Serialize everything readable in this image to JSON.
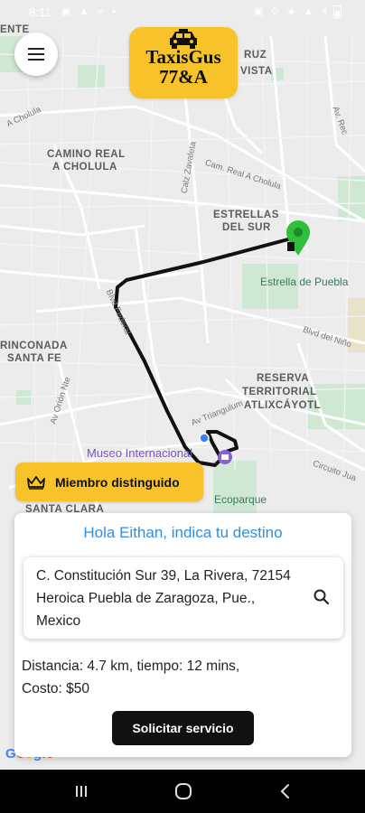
{
  "status_bar": {
    "time": "8:11",
    "left_icons": "▣ ▲ ∞ •",
    "right_icons": "▣ ⊙ ◈ ▲ 4"
  },
  "map_labels": {
    "ente": "ENTE",
    "cruz": "RUZ",
    "vista": "VISTA",
    "camino_real_1": "CAMINO REAL",
    "camino_real_2": "A CHOLULA",
    "estrellas_1": "ESTRELLAS",
    "estrellas_2": "DEL SUR",
    "estrella_puebla": "Estrella de Puebla",
    "rinconada_1": "RINCONADA",
    "rinconada_2": "SANTA FE",
    "reserva_1": "RESERVA",
    "reserva_2": "TERRITORIAL",
    "reserva_3": "ATLIXCÁYOTL",
    "museo_1": "Museo Internacional",
    "ecoparque": "Ecoparque",
    "santa_clara": "SANTA CLARA",
    "road_cholula": "A Cholula",
    "road_camreal": "Cam. Real A Cholula",
    "road_zavaleta": "Calz Zavaleta",
    "road_blvd_nino": "Blvd del Niño",
    "road_triangulum": "Av Triangulum",
    "road_orion": "Av Orión Nte",
    "road_blvd_fed": "Blvd Federal",
    "road_circuito": "Circuito Jua",
    "road_rec": "Av. Rec"
  },
  "logo": {
    "line1": "TaxisGus",
    "line2": "77&A"
  },
  "badge": {
    "label": "Miembro distinguido"
  },
  "card": {
    "greeting": "Hola Eithan, indica tu destino",
    "address": "C. Constitución Sur 39, La Rivera, 72154 Heroica Puebla de Zaragoza, Pue., Mexico",
    "distance_line": "Distancia: 4.7 km, tiempo: 12 mins,",
    "cost_line": "Costo: $50",
    "request_button": "Solicitar servicio"
  },
  "google_wordmark": "Google",
  "colors": {
    "accent_yellow": "#f8c22a",
    "greeting_blue": "#2f8ee0",
    "button_black": "#111111",
    "pin_green": "#2fbf3a"
  }
}
